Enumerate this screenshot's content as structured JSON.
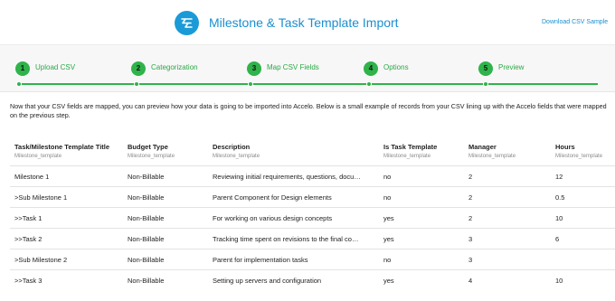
{
  "header": {
    "title": "Milestone & Task Template Import",
    "download_label": "Download CSV Sample",
    "logo_icon": "sliders-icon",
    "brand_color": "#1a9bd7"
  },
  "steps": [
    {
      "number": "1",
      "label": "Upload CSV"
    },
    {
      "number": "2",
      "label": "Categorization"
    },
    {
      "number": "3",
      "label": "Map CSV Fields"
    },
    {
      "number": "4",
      "label": "Options"
    },
    {
      "number": "5",
      "label": "Preview"
    }
  ],
  "step_color": "#2fb34a",
  "intro": "Now that your CSV fields are mapped, you can preview how your data is going to be imported into Accelo. Below is a small example of records from your CSV lining up with the Accelo fields that were mapped on the previous step.",
  "table": {
    "columns": [
      {
        "title": "Task/Milestone Template Title",
        "sub": "Milestone_template"
      },
      {
        "title": "Budget Type",
        "sub": "Milestone_template"
      },
      {
        "title": "Description",
        "sub": "Milestone_template"
      },
      {
        "title": "Is Task Template",
        "sub": "Milestone_template"
      },
      {
        "title": "Manager",
        "sub": "Milestone_template"
      },
      {
        "title": "Hours",
        "sub": "Milestone_template"
      }
    ],
    "rows": [
      [
        "Milestone 1",
        "Non-Billable",
        "Reviewing initial requirements, questions, docu…",
        "no",
        "2",
        "12"
      ],
      [
        ">Sub Milestone 1",
        "Non-Billable",
        "Parent Component for Design elements",
        "no",
        "2",
        "0.5"
      ],
      [
        ">>Task 1",
        "Non-Billable",
        "For working on various design concepts",
        "yes",
        "2",
        "10"
      ],
      [
        ">>Task 2",
        "Non-Billable",
        "Tracking time spent on revisions to the final co…",
        "yes",
        "3",
        "6"
      ],
      [
        ">Sub Milestone 2",
        "Non-Billable",
        "Parent for implementation tasks",
        "no",
        "3",
        ""
      ],
      [
        ">>Task 3",
        "Non-Billable",
        "Setting up servers and configuration",
        "yes",
        "4",
        "10"
      ]
    ]
  }
}
